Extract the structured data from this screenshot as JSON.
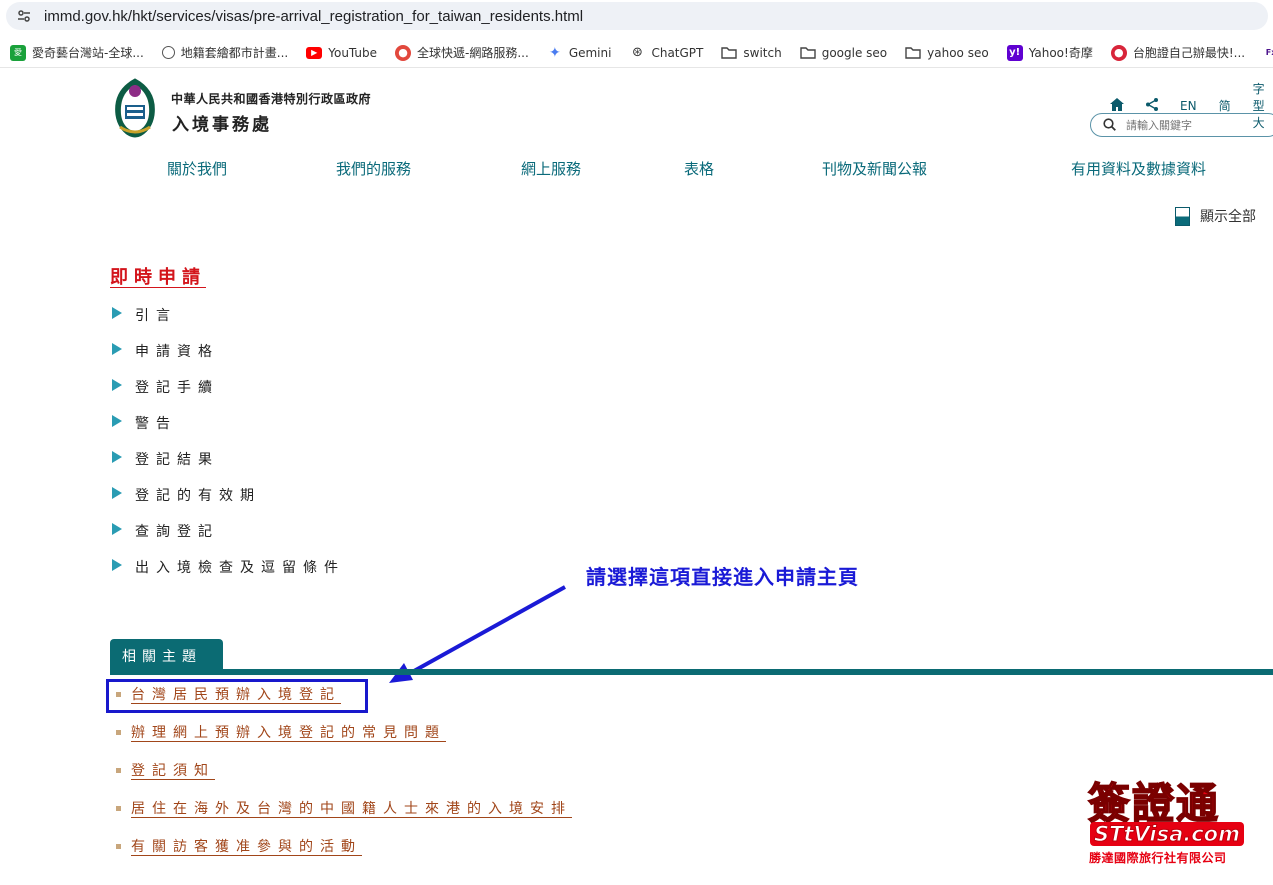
{
  "browser": {
    "url": "immd.gov.hk/hkt/services/visas/pre-arrival_registration_for_taiwan_residents.html",
    "bookmarks": [
      {
        "label": "愛奇藝台灣站-全球...",
        "icon": "iqiyi-icon"
      },
      {
        "label": "地籍套繪都市計畫...",
        "icon": "globe-icon"
      },
      {
        "label": "YouTube",
        "icon": "youtube-icon"
      },
      {
        "label": "全球快遞-網路服務...",
        "icon": "site-icon"
      },
      {
        "label": "Gemini",
        "icon": "gemini-icon"
      },
      {
        "label": "ChatGPT",
        "icon": "chatgpt-icon"
      },
      {
        "label": "switch",
        "icon": "folder-icon"
      },
      {
        "label": "google seo",
        "icon": "folder-icon"
      },
      {
        "label": "yahoo seo",
        "icon": "folder-icon"
      },
      {
        "label": "Yahoo!奇摩",
        "icon": "yahoo-icon"
      },
      {
        "label": "台胞證自己辦最快!...",
        "icon": "site-icon"
      },
      {
        "label": "De",
        "icon": "fedex-icon"
      }
    ]
  },
  "header": {
    "gov_name": "中華人民共和國香港特別行政區政府",
    "dept_name": "入境事務處",
    "toplinks": {
      "lang_en": "EN",
      "lang_sc": "简",
      "font_size": "字型大"
    },
    "search_placeholder": "請輸入關鍵字"
  },
  "nav": [
    "關於我們",
    "我們的服務",
    "網上服務",
    "表格",
    "刊物及新聞公報",
    "有用資料及數據資料"
  ],
  "show_all": "顯示全部",
  "section": {
    "title": "即時申請",
    "toc": [
      "引言",
      "申請資格",
      "登記手續",
      "警告",
      "登記結果",
      "登記的有效期",
      "查詢登記",
      "出入境檢查及逗留條件"
    ]
  },
  "annotation": "請選擇這項直接進入申請主頁",
  "related": {
    "tab": "相關主題",
    "items": [
      "台灣居民預辦入境登記",
      "辦理網上預辦入境登記的常見問題",
      "登記須知",
      "居住在海外及台灣的中國籍人士來港的入境安排",
      "有關訪客獲准參與的活動"
    ]
  },
  "watermark": {
    "big": "簽證通",
    "domain": "STtVisa.com",
    "company": "勝達國際旅行社有限公司"
  },
  "colors": {
    "teal": "#0b6b73",
    "link": "#a1461a",
    "title_red": "#d3141b",
    "annot_blue": "#1a1ad6"
  }
}
